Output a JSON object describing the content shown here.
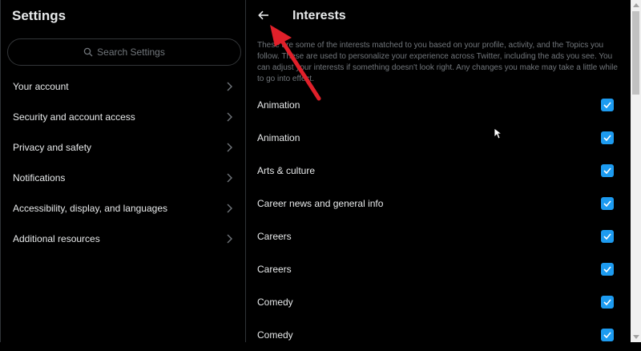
{
  "settings": {
    "title": "Settings",
    "search_placeholder": "Search Settings",
    "menu": [
      {
        "label": "Your account"
      },
      {
        "label": "Security and account access"
      },
      {
        "label": "Privacy and safety"
      },
      {
        "label": "Notifications"
      },
      {
        "label": "Accessibility, display, and languages"
      },
      {
        "label": "Additional resources"
      }
    ]
  },
  "interests": {
    "title": "Interests",
    "description": "These are some of the interests matched to you based on your profile, activity, and the Topics you follow. These are used to personalize your experience across Twitter, including the ads you see. You can adjust your interests if something doesn't look right. Any changes you make may take a little while to go into effect.",
    "items": [
      {
        "label": "Animation",
        "checked": true
      },
      {
        "label": "Animation",
        "checked": true
      },
      {
        "label": "Arts & culture",
        "checked": true
      },
      {
        "label": "Career news and general info",
        "checked": true
      },
      {
        "label": "Careers",
        "checked": true
      },
      {
        "label": "Careers",
        "checked": true
      },
      {
        "label": "Comedy",
        "checked": true
      },
      {
        "label": "Comedy",
        "checked": true
      }
    ]
  },
  "colors": {
    "accent": "#1d9bf0",
    "annotation": "#e0202a",
    "background": "#000000",
    "muted_text": "#71767b"
  },
  "icons": {
    "back": "arrow-left-icon",
    "search": "search-icon",
    "chevron": "chevron-right-icon",
    "check": "checkmark-icon"
  }
}
